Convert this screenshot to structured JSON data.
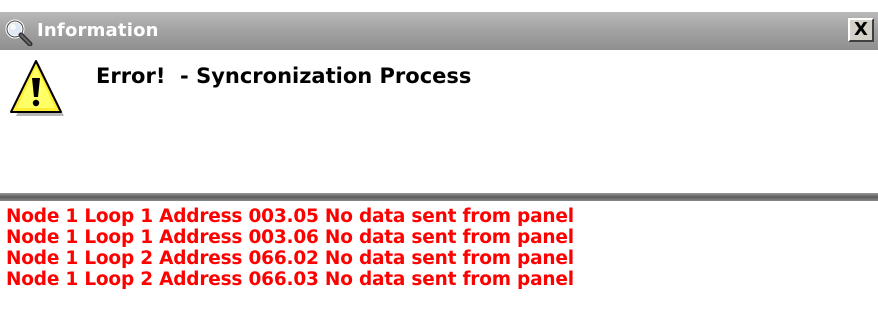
{
  "window": {
    "title": "Information",
    "close_label": "X"
  },
  "message": {
    "heading": "Error!  - Syncronization Process"
  },
  "log": {
    "color": "#ff0000",
    "lines": [
      "Node 1 Loop 1 Address 003.05 No data sent from panel",
      "Node 1 Loop 1 Address 003.06 No data sent from panel",
      "Node 1 Loop 2 Address 066.02 No data sent from panel",
      "Node 1 Loop 2 Address 066.03 No data sent from panel"
    ]
  },
  "icons": {
    "title": "magnifier-icon",
    "message": "warning-icon",
    "close": "close-icon"
  }
}
